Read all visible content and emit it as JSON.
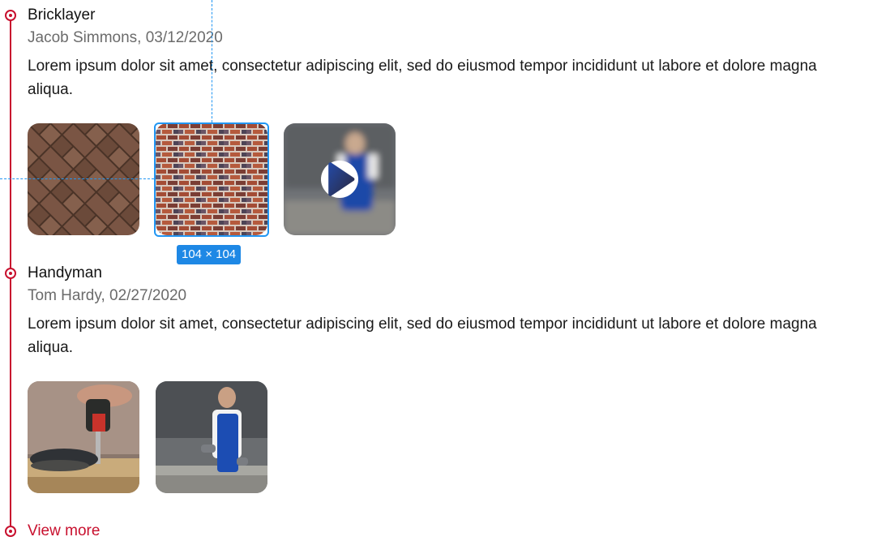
{
  "colors": {
    "accent": "#c8102e",
    "selection": "#2196f3",
    "meta_text": "#6b6b6b"
  },
  "entries": [
    {
      "title": "Bricklayer",
      "meta": "Jacob Simmons, 03/12/2020",
      "body": "Lorem ipsum dolor sit amet, consectetur adipiscing elit, sed do eiusmod tempor incididunt ut labore et dolore magna aliqua.",
      "media": [
        "herringbone-brick-photo",
        "red-brick-wall-photo",
        "worker-video-thumbnail"
      ]
    },
    {
      "title": "Handyman",
      "meta": "Tom Hardy, 02/27/2020",
      "body": "Lorem ipsum dolor sit amet, consectetur adipiscing elit, sed do eiusmod tempor incididunt ut labore et dolore magna aliqua.",
      "media": [
        "drill-hands-photo",
        "worker-blue-overalls-photo"
      ]
    }
  ],
  "selection": {
    "size_label": "104 × 104"
  },
  "view_more": "View more",
  "icons": {
    "timeline_dot": "circle-dot-icon",
    "play": "play-icon"
  }
}
